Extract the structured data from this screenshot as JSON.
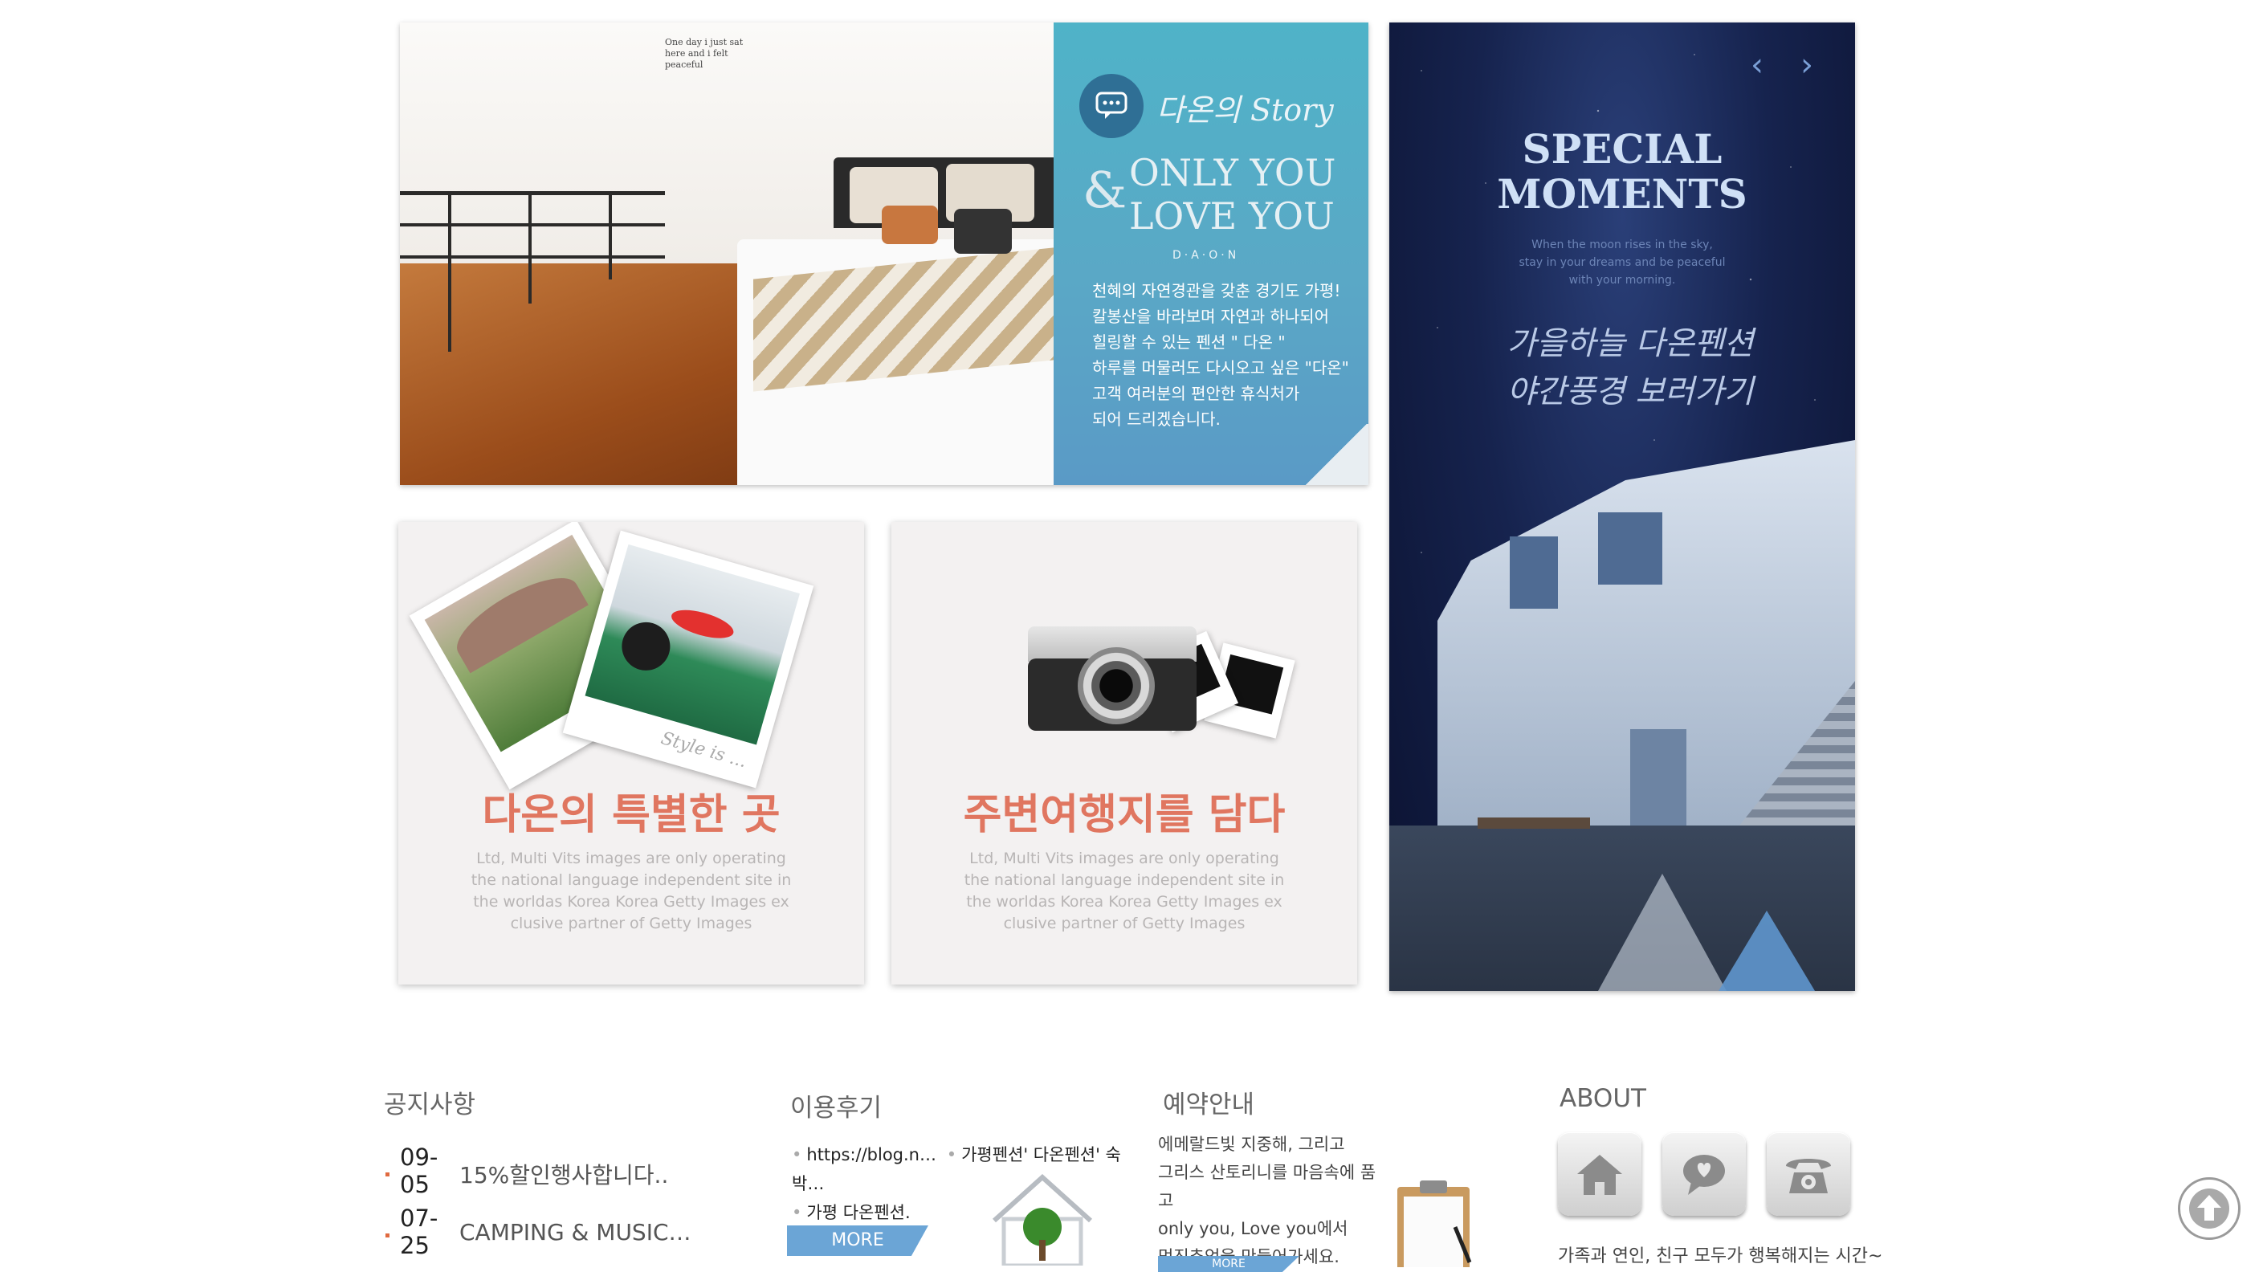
{
  "story": {
    "title": "다온의 Story",
    "amp": "&",
    "only_you": "ONLY YOU",
    "love_you": "LOVE YOU",
    "daon": "D·A·O·N",
    "lines": [
      "천혜의 자연경관을 갖춘 경기도 가평!",
      "칼봉산을 바라보며 자연과 하나되어",
      "힐링할 수 있는 펜션 \" 다온 \"",
      "하루를 머물러도 다시오고 싶은 \"다온\"",
      "고객 여러분의 편안한 휴식처가",
      "되어 드리겠습니다."
    ],
    "wall_note": "One day i just sat here and i felt peaceful",
    "accent": "#5aaac6"
  },
  "cards": [
    {
      "headline": "다온의 특별한 곳",
      "photo_caption": "Style is ...",
      "body": [
        "Ltd, Multi Vits images are only operating",
        "the national language independent site in",
        "the worldas Korea Korea Getty Images ex",
        "clusive partner of Getty Images"
      ]
    },
    {
      "headline": "주변여행지를 담다",
      "body": [
        "Ltd, Multi Vits images are only operating",
        "the national language independent site in",
        "the worldas Korea Korea Getty Images ex",
        "clusive partner of Getty Images"
      ]
    }
  ],
  "night": {
    "prev": "‹",
    "next": "›",
    "title_1": "SPECIAL",
    "title_2": "MOMENTS",
    "sub": [
      "When the moon rises in the sky,",
      "stay in your dreams and be peaceful",
      "with your morning."
    ],
    "script_1": "가을하늘 다온펜션",
    "script_2": "야간풍경 보러가기"
  },
  "notice": {
    "title": "공지사항",
    "items": [
      {
        "date_1": "09-",
        "date_2": "05",
        "text": "15%할인행사합니다.."
      },
      {
        "date_1": "07-",
        "date_2": "25",
        "text": "CAMPING & MUSIC…"
      }
    ]
  },
  "review": {
    "title": "이용후기",
    "items": [
      "https://blog.n…",
      "가평펜션' 다온펜션' 숙박…",
      "가평 다온펜션."
    ],
    "more": "MORE"
  },
  "reserve": {
    "title": "예약안내",
    "lines": [
      "에메랄드빛 지중해, 그리고",
      "그리스 산토리니를 마음속에 품고",
      "only you, Love you에서",
      "멋진추억을 만들어가세요."
    ],
    "more": "MORE"
  },
  "about": {
    "title": "ABOUT",
    "text": "가족과 연인, 친구 모두가 행복해지는 시간~"
  },
  "colors": {
    "notice_dot": "#e06a40",
    "more_button": "#6ba5d6",
    "headline": "#e07660"
  }
}
